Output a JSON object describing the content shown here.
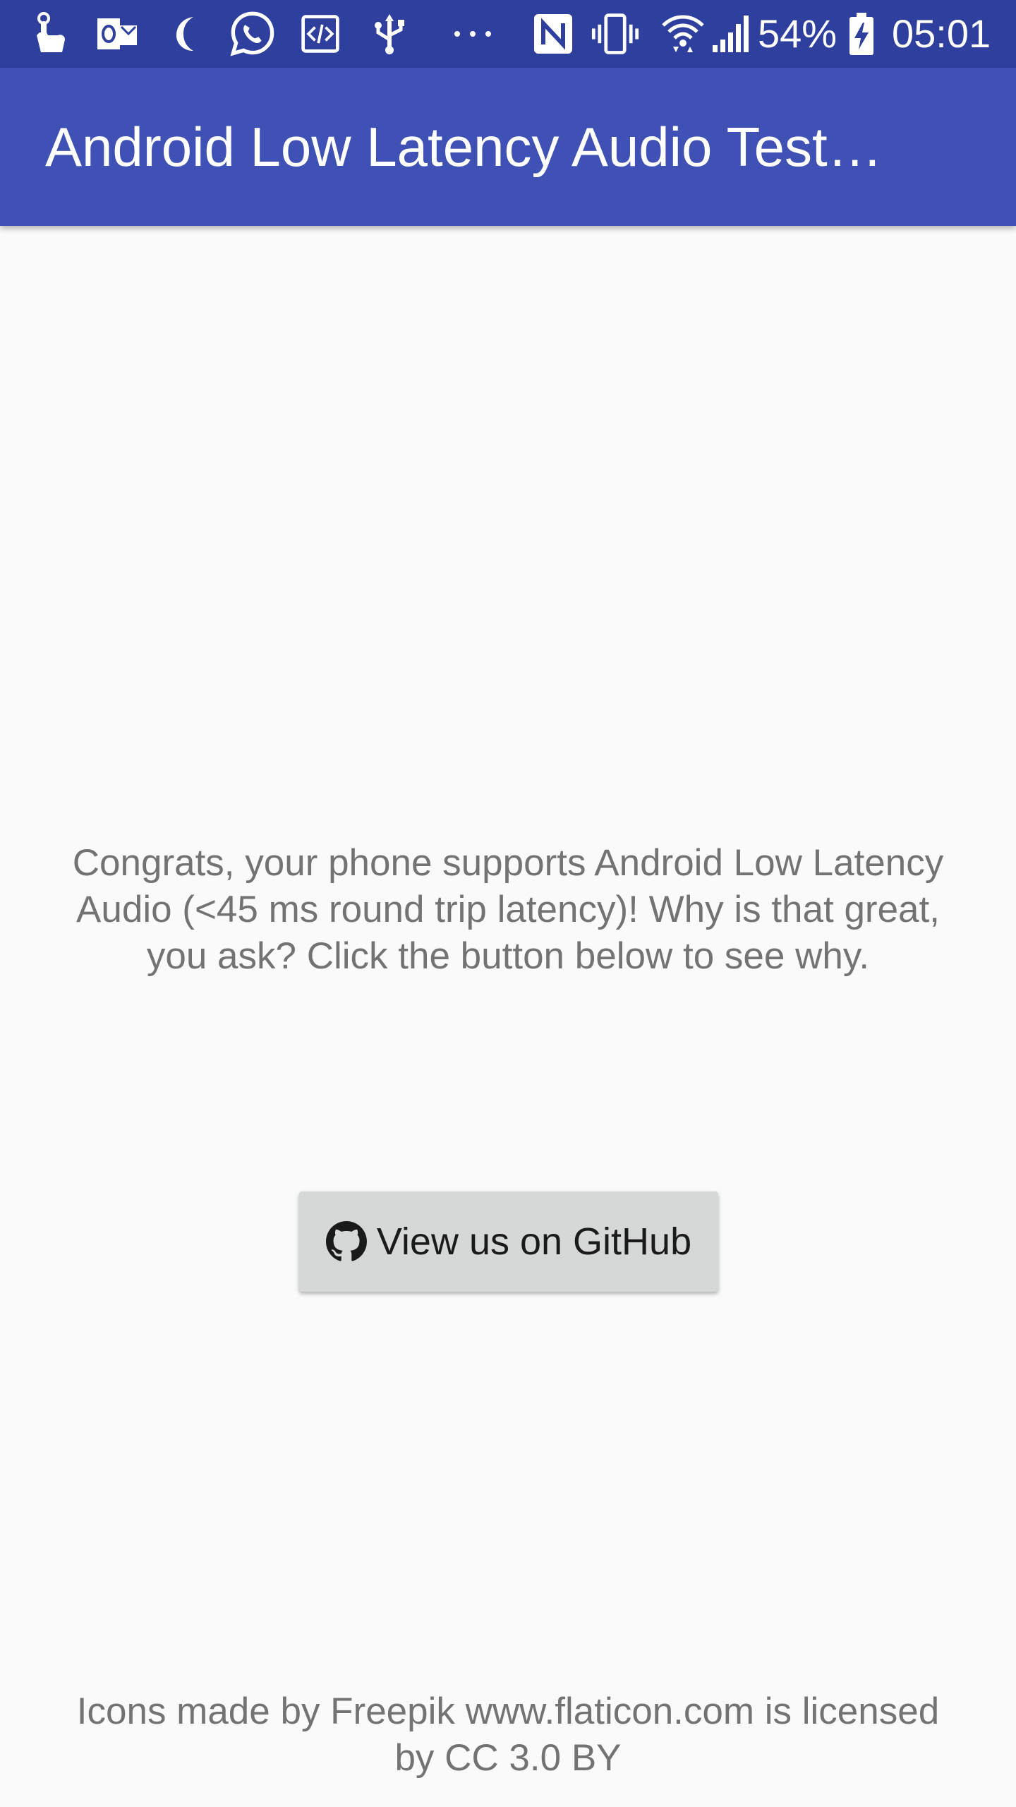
{
  "status_bar": {
    "background": "#2f3f9e",
    "left_icons": [
      "touch-gesture-icon",
      "outlook-icon",
      "moon-icon",
      "whatsapp-icon",
      "developer-code-icon",
      "usb-icon",
      "more-notifications-icon"
    ],
    "right_icons": [
      "nfc-icon",
      "vibrate-icon",
      "wifi-icon",
      "signal-icon",
      "battery-charging-icon"
    ],
    "battery": "54%",
    "time": "05:01"
  },
  "app_bar": {
    "title": "Android Low Latency Audio Test…",
    "background": "#3f51b5"
  },
  "main": {
    "message": "Congrats, your phone supports Android Low Latency Audio (<45 ms round trip latency)! Why is that great, you ask? Click the button below to see why.",
    "github_button": {
      "label": "View us on GitHub",
      "icon": "github-icon"
    }
  },
  "footer": {
    "credit": "Icons made by Freepik www.flaticon.com is licensed by CC 3.0 BY"
  }
}
